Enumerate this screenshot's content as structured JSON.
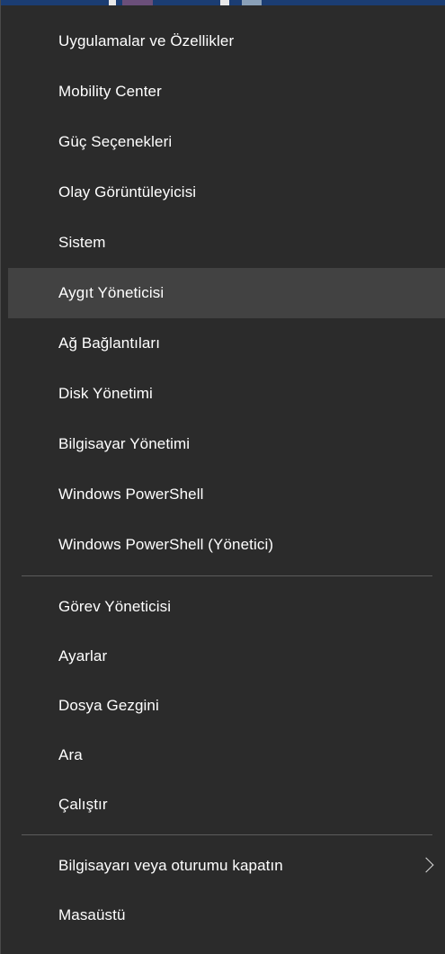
{
  "menu": {
    "group1": [
      "Uygulamalar ve Özellikler",
      "Mobility Center",
      "Güç Seçenekleri",
      "Olay Görüntüleyicisi",
      "Sistem",
      "Aygıt Yöneticisi",
      "Ağ Bağlantıları",
      "Disk Yönetimi",
      "Bilgisayar Yönetimi",
      "Windows PowerShell",
      "Windows PowerShell (Yönetici)"
    ],
    "group2": [
      "Görev Yöneticisi",
      "Ayarlar",
      "Dosya Gezgini",
      "Ara",
      "Çalıştır"
    ],
    "group3": [
      "Bilgisayarı veya oturumu kapatın",
      "Masaüstü"
    ],
    "highlighted_item": "Aygıt Yöneticisi",
    "submenu_indicator_icon": "chevron-right-icon"
  },
  "colors": {
    "menu_background": "#2b2b2b",
    "hover_background": "#424242",
    "text": "#ffffff",
    "separator": "#5c5c5c",
    "taskbar_strip": "#1b3d73"
  }
}
